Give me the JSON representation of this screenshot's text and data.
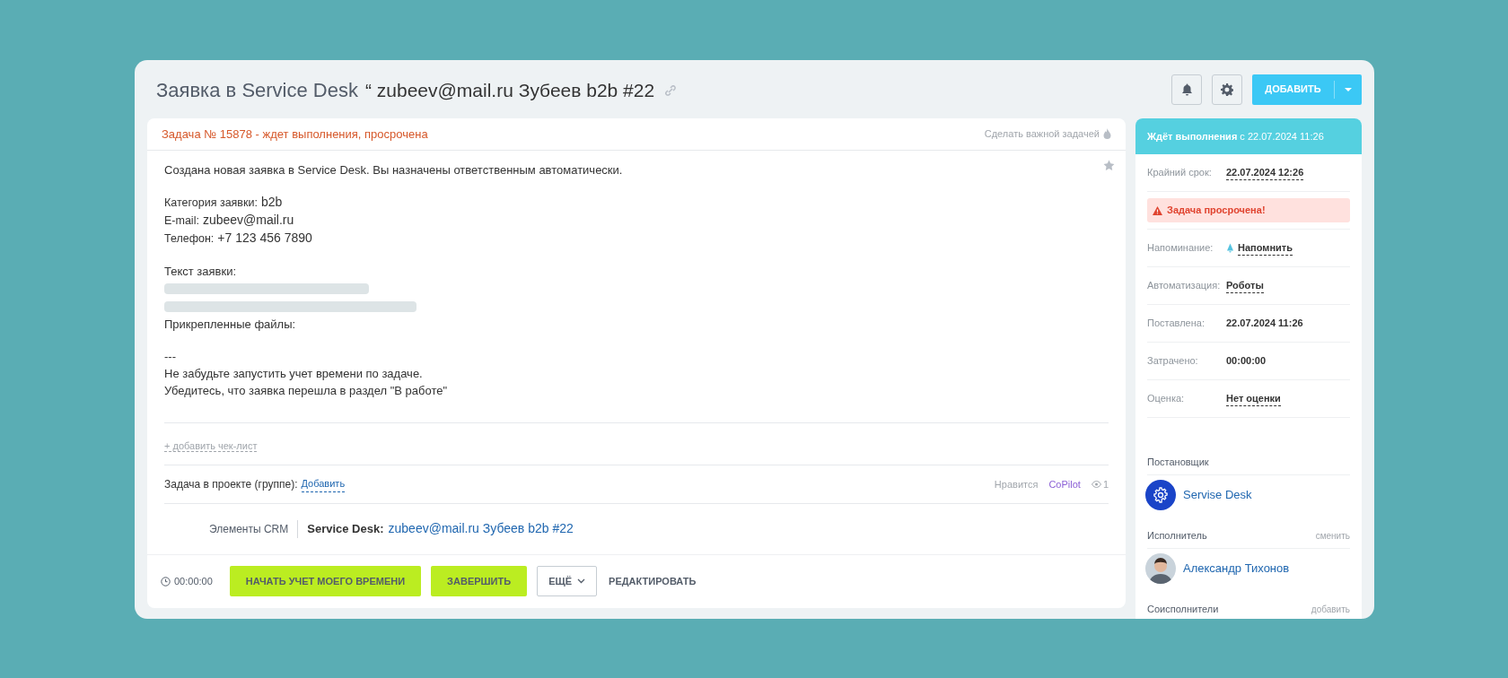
{
  "title": {
    "main": "Заявка в Service Desk",
    "subject": "“ zubeev@mail.ru Зубеев b2b #22"
  },
  "header": {
    "add_button": "ДОБАВИТЬ"
  },
  "task": {
    "status": "Задача № 15878 - ждет выполнения, просрочена",
    "important_link": "Сделать важной задачей",
    "description": [
      [
        {
          "kind": "text",
          "text": "Создана новая заявка в Service Desk. Вы назначены ответственным автоматически."
        }
      ],
      [
        {
          "kind": "field",
          "label": "Категория заявки:",
          "value": "b2b"
        },
        {
          "kind": "field",
          "label": "E-mail:",
          "value": "zubeev@mail.ru"
        },
        {
          "kind": "field",
          "label": "Телефон:",
          "value": "+7 123 456 7890"
        }
      ],
      [
        {
          "kind": "text",
          "text": "Текст заявки:"
        },
        {
          "kind": "redacted"
        },
        {
          "kind": "redacted"
        },
        {
          "kind": "text",
          "text": "Прикрепленные файлы:"
        }
      ],
      [
        {
          "kind": "text",
          "text": "---"
        },
        {
          "kind": "text",
          "text": "Не забудьте запустить учет времени по задаче."
        },
        {
          "kind": "text",
          "text": "Убедитесь, что заявка перешла в раздел \"В работе\""
        }
      ]
    ],
    "checklist_link": "+ добавить чек-лист",
    "project": {
      "label": "Задача в проекте (группе):",
      "link": "Добавить"
    },
    "likes": "Нравится",
    "copilot": "CoPilot",
    "views": "1",
    "crm": {
      "label": "Элементы CRM",
      "entity_label": "Service Desk:",
      "entity": "zubeev@mail.ru Зубеев b2b #22"
    }
  },
  "footer": {
    "timer": "00:00:00",
    "buttons": [
      {
        "kind": "primary",
        "label": "НАЧАТЬ УЧЕТ МОЕГО ВРЕМЕНИ"
      },
      {
        "kind": "primary",
        "label": "ЗАВЕРШИТЬ"
      },
      {
        "kind": "dropdown",
        "label": "ЕЩЁ"
      },
      {
        "kind": "text",
        "label": "РЕДАКТИРОВАТЬ"
      }
    ]
  },
  "sidebar": {
    "status_header": "**Ждёт выполнения** с 22.07.2024 11:26",
    "fields": [
      {
        "kind": "link",
        "label": "Крайний срок:",
        "value": "22.07.2024 12:26"
      },
      {
        "kind": "alert",
        "value": "Задача просрочена!"
      },
      {
        "kind": "reminder",
        "label": "Напоминание:",
        "value": "Напомнить"
      },
      {
        "kind": "link",
        "label": "Автоматизация:",
        "value": "Роботы"
      },
      {
        "kind": "plain",
        "label": "Поставлена:",
        "value": "22.07.2024 11:26"
      },
      {
        "kind": "plain",
        "label": "Затрачено:",
        "value": "00:00:00"
      },
      {
        "kind": "link",
        "label": "Оценка:",
        "value": "Нет оценки"
      }
    ],
    "roles": [
      {
        "title": "Постановщик",
        "person": {
          "name": "Servise Desk",
          "kind": "system"
        }
      },
      {
        "title": "Исполнитель",
        "action": "сменить",
        "person": {
          "name": "Александр Тихонов",
          "kind": "photo"
        }
      },
      {
        "title": "Соисполнители",
        "action": "добавить"
      }
    ]
  }
}
